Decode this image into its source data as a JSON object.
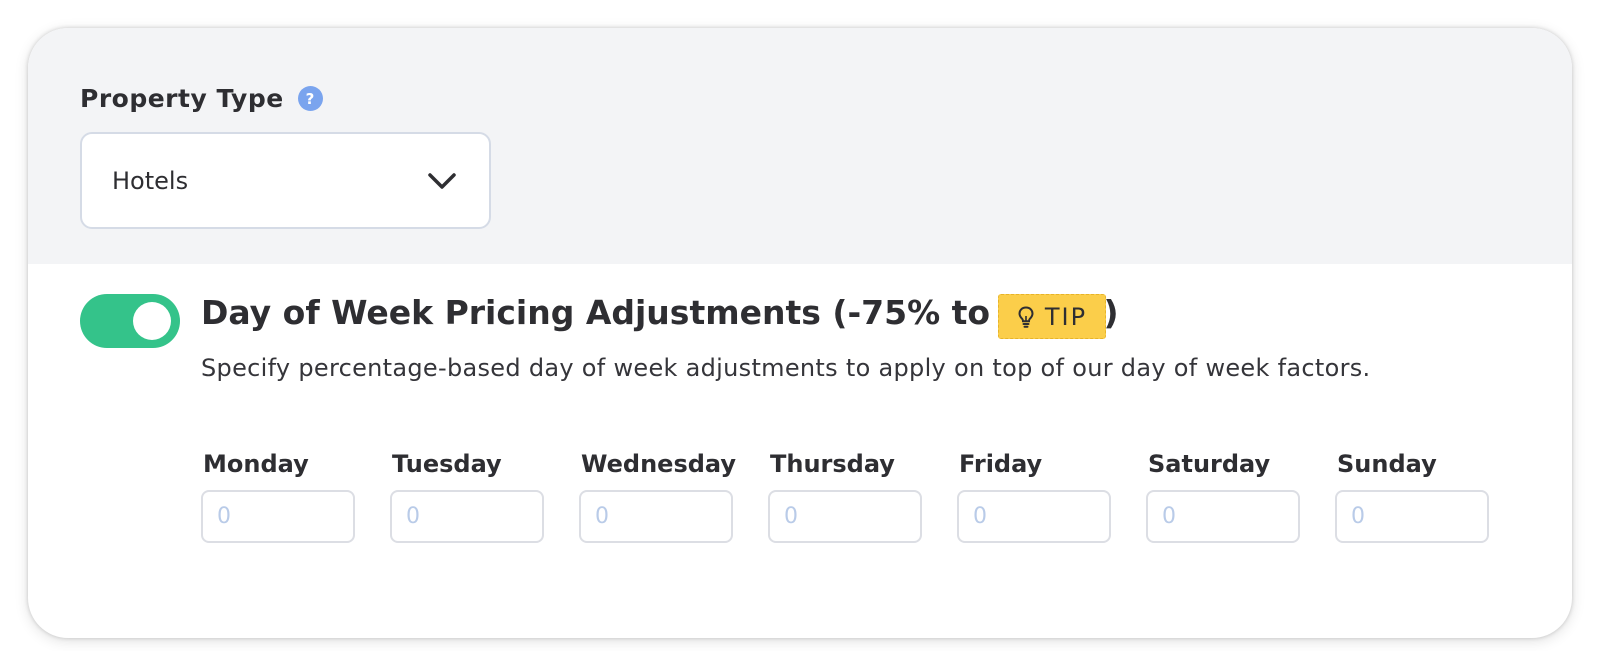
{
  "property": {
    "label": "Property Type",
    "help_icon": "question-mark-icon",
    "help_glyph": "?",
    "selected": "Hotels",
    "chevron_icon": "chevron-down-icon"
  },
  "adjustments": {
    "enabled": true,
    "title": "Day of Week Pricing Adjustments (-75% to 500%)",
    "tip_label": "TIP",
    "tip_icon": "lightbulb-icon",
    "description": "Specify percentage-based day of week adjustments to apply on top of our day of week factors.",
    "days": [
      {
        "label": "Monday",
        "placeholder": "0"
      },
      {
        "label": "Tuesday",
        "placeholder": "0"
      },
      {
        "label": "Wednesday",
        "placeholder": "0"
      },
      {
        "label": "Thursday",
        "placeholder": "0"
      },
      {
        "label": "Friday",
        "placeholder": "0"
      },
      {
        "label": "Saturday",
        "placeholder": "0"
      },
      {
        "label": "Sunday",
        "placeholder": "0"
      }
    ]
  },
  "colors": {
    "toggle_on": "#34c38a",
    "tip_badge": "#fbce4a",
    "help_icon": "#7aa4ee",
    "panel_bg": "#f3f4f6"
  }
}
